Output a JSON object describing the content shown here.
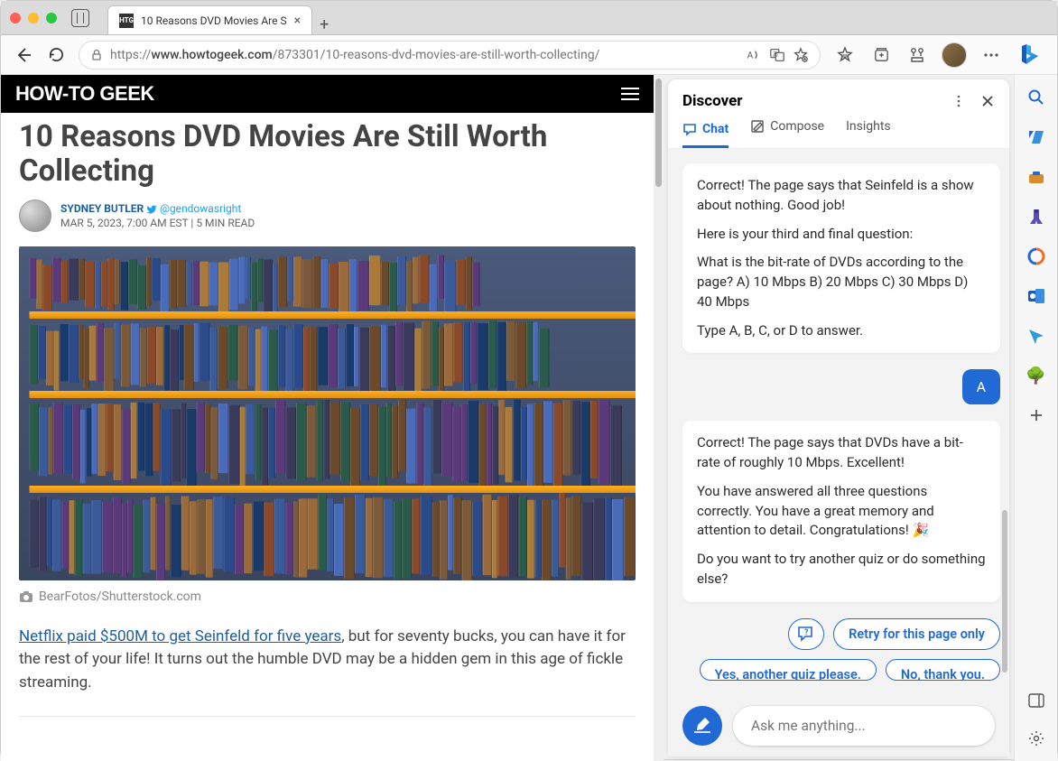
{
  "window": {
    "tab_title": "10 Reasons DVD Movies Are S",
    "favicon_text": "HTG",
    "url_prefix": "https://",
    "url_host": "www.howtogeek.com",
    "url_path": "/873301/10-reasons-dvd-movies-are-still-worth-collecting/"
  },
  "article": {
    "site_name": "How-To Geek",
    "title": "10 Reasons DVD Movies Are Still Worth Collecting",
    "author": "SYDNEY BUTLER",
    "twitter_handle": "@gendowasright",
    "meta": "MAR 5, 2023, 7:00 AM EST | 5 MIN READ",
    "caption": "BearFotos/Shutterstock.com",
    "link_text": "Netflix paid $500M to get Seinfeld for five years",
    "para_rest": ", but for seventy bucks, you can have it for the rest of your life! It turns out the humble DVD may be a hidden gem in this age of fickle streaming."
  },
  "panel": {
    "title": "Discover",
    "tabs": {
      "chat": "Chat",
      "compose": "Compose",
      "insights": "Insights"
    },
    "msg1": {
      "p1": "Correct! The page says that Seinfeld is a show about nothing. Good job!",
      "p2": "Here is your third and final question:",
      "p3": "What is the bit-rate of DVDs according to the page? A) 10 Mbps B) 20 Mbps C) 30 Mbps D) 40 Mbps",
      "p4": "Type A, B, C, or D to answer."
    },
    "user_answer": "A",
    "msg2": {
      "p1": "Correct! The page says that DVDs have a bit-rate of roughly 10 Mbps. Excellent!",
      "p2": "You have answered all three questions correctly. You have a great memory and attention to detail. Congratulations! 🎉",
      "p3": "Do you want to try another quiz or do something else?"
    },
    "suggestions": {
      "retry": "Retry for this page only",
      "yes": "Yes, another quiz please.",
      "no": "No, thank you."
    },
    "input_placeholder": "Ask me anything..."
  }
}
